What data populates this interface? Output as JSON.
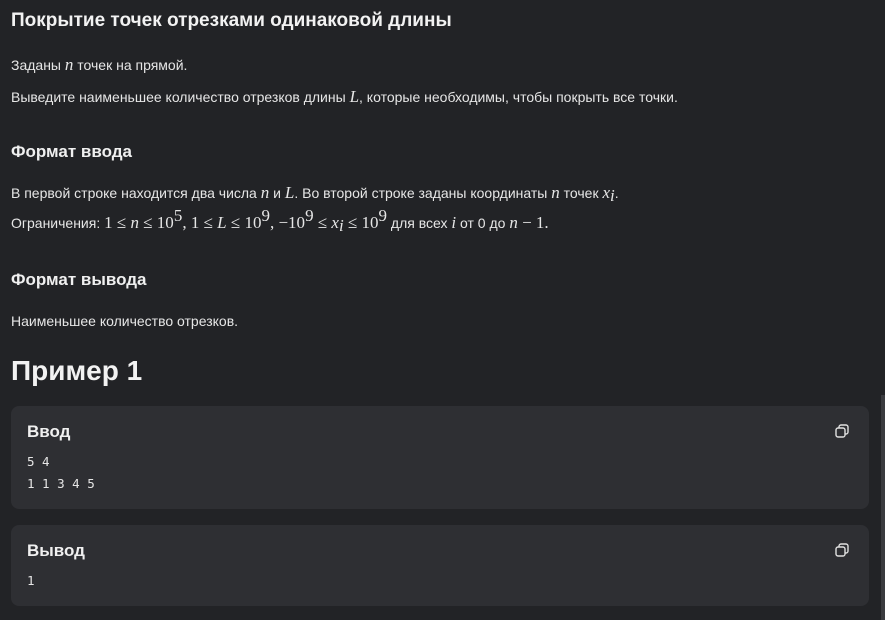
{
  "problem": {
    "title": "Покрытие точек отрезками одинаковой длины",
    "line1": {
      "pre": "Заданы ",
      "n": "n",
      "post": " точек на прямой."
    },
    "line2": {
      "pre": "Выведите наименьшее количество отрезков длины ",
      "L": "L",
      "post": ", которые необходимы, чтобы покрыть все точки."
    }
  },
  "input_format": {
    "heading": "Формат ввода",
    "line1": {
      "pre": "В первой строке находится два числа ",
      "n": "n",
      "and": " и ",
      "L": "L",
      "mid": ". Во второй строке заданы координаты ",
      "n2": "n",
      "mid2": " точек ",
      "x": "x",
      "i": "i",
      "end": "."
    },
    "constraints": {
      "label": "Ограничения: ",
      "c1_a": "1 ≤ ",
      "c1_n": "n",
      "c1_b": " ≤ 10",
      "c1_exp": "5",
      "c2_a": ", 1 ≤ ",
      "c2_L": "L",
      "c2_b": " ≤ 10",
      "c2_exp": "9",
      "c3_a": ", −10",
      "c3_exp1": "9",
      "c3_b": " ≤ ",
      "c3_x": "x",
      "c3_i": "i",
      "c3_c": " ≤ 10",
      "c3_exp2": "9",
      "tail1": " для всех ",
      "tail_i": "i",
      "tail2": " от 0 до ",
      "tail_n": "n",
      "tail3": " − 1."
    }
  },
  "output_format": {
    "heading": "Формат вывода",
    "text": "Наименьшее количество отрезков."
  },
  "example": {
    "heading": "Пример 1",
    "input_label": "Ввод",
    "input_text": "5 4\n1 1 3 4 5",
    "output_label": "Вывод",
    "output_text": "1",
    "copy_icon": "copy-icon"
  }
}
